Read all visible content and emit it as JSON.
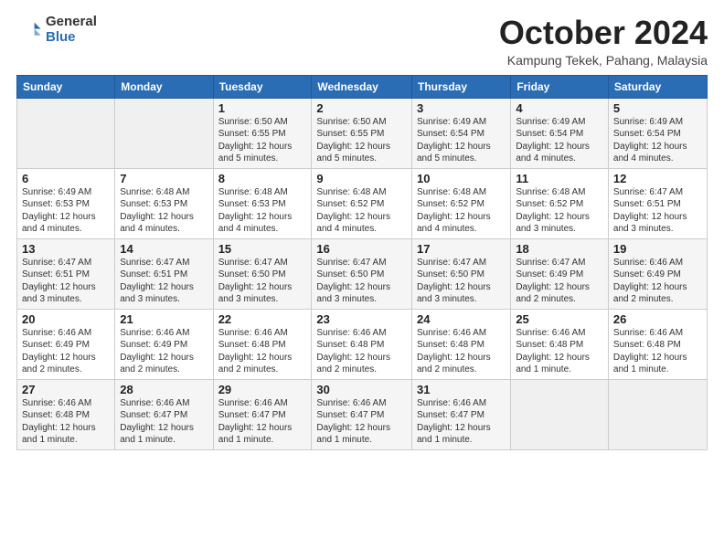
{
  "logo": {
    "general": "General",
    "blue": "Blue"
  },
  "header": {
    "month": "October 2024",
    "location": "Kampung Tekek, Pahang, Malaysia"
  },
  "weekdays": [
    "Sunday",
    "Monday",
    "Tuesday",
    "Wednesday",
    "Thursday",
    "Friday",
    "Saturday"
  ],
  "weeks": [
    [
      {
        "day": "",
        "sunrise": "",
        "sunset": "",
        "daylight": ""
      },
      {
        "day": "",
        "sunrise": "",
        "sunset": "",
        "daylight": ""
      },
      {
        "day": "1",
        "sunrise": "Sunrise: 6:50 AM",
        "sunset": "Sunset: 6:55 PM",
        "daylight": "Daylight: 12 hours and 5 minutes."
      },
      {
        "day": "2",
        "sunrise": "Sunrise: 6:50 AM",
        "sunset": "Sunset: 6:55 PM",
        "daylight": "Daylight: 12 hours and 5 minutes."
      },
      {
        "day": "3",
        "sunrise": "Sunrise: 6:49 AM",
        "sunset": "Sunset: 6:54 PM",
        "daylight": "Daylight: 12 hours and 5 minutes."
      },
      {
        "day": "4",
        "sunrise": "Sunrise: 6:49 AM",
        "sunset": "Sunset: 6:54 PM",
        "daylight": "Daylight: 12 hours and 4 minutes."
      },
      {
        "day": "5",
        "sunrise": "Sunrise: 6:49 AM",
        "sunset": "Sunset: 6:54 PM",
        "daylight": "Daylight: 12 hours and 4 minutes."
      }
    ],
    [
      {
        "day": "6",
        "sunrise": "Sunrise: 6:49 AM",
        "sunset": "Sunset: 6:53 PM",
        "daylight": "Daylight: 12 hours and 4 minutes."
      },
      {
        "day": "7",
        "sunrise": "Sunrise: 6:48 AM",
        "sunset": "Sunset: 6:53 PM",
        "daylight": "Daylight: 12 hours and 4 minutes."
      },
      {
        "day": "8",
        "sunrise": "Sunrise: 6:48 AM",
        "sunset": "Sunset: 6:53 PM",
        "daylight": "Daylight: 12 hours and 4 minutes."
      },
      {
        "day": "9",
        "sunrise": "Sunrise: 6:48 AM",
        "sunset": "Sunset: 6:52 PM",
        "daylight": "Daylight: 12 hours and 4 minutes."
      },
      {
        "day": "10",
        "sunrise": "Sunrise: 6:48 AM",
        "sunset": "Sunset: 6:52 PM",
        "daylight": "Daylight: 12 hours and 4 minutes."
      },
      {
        "day": "11",
        "sunrise": "Sunrise: 6:48 AM",
        "sunset": "Sunset: 6:52 PM",
        "daylight": "Daylight: 12 hours and 3 minutes."
      },
      {
        "day": "12",
        "sunrise": "Sunrise: 6:47 AM",
        "sunset": "Sunset: 6:51 PM",
        "daylight": "Daylight: 12 hours and 3 minutes."
      }
    ],
    [
      {
        "day": "13",
        "sunrise": "Sunrise: 6:47 AM",
        "sunset": "Sunset: 6:51 PM",
        "daylight": "Daylight: 12 hours and 3 minutes."
      },
      {
        "day": "14",
        "sunrise": "Sunrise: 6:47 AM",
        "sunset": "Sunset: 6:51 PM",
        "daylight": "Daylight: 12 hours and 3 minutes."
      },
      {
        "day": "15",
        "sunrise": "Sunrise: 6:47 AM",
        "sunset": "Sunset: 6:50 PM",
        "daylight": "Daylight: 12 hours and 3 minutes."
      },
      {
        "day": "16",
        "sunrise": "Sunrise: 6:47 AM",
        "sunset": "Sunset: 6:50 PM",
        "daylight": "Daylight: 12 hours and 3 minutes."
      },
      {
        "day": "17",
        "sunrise": "Sunrise: 6:47 AM",
        "sunset": "Sunset: 6:50 PM",
        "daylight": "Daylight: 12 hours and 3 minutes."
      },
      {
        "day": "18",
        "sunrise": "Sunrise: 6:47 AM",
        "sunset": "Sunset: 6:49 PM",
        "daylight": "Daylight: 12 hours and 2 minutes."
      },
      {
        "day": "19",
        "sunrise": "Sunrise: 6:46 AM",
        "sunset": "Sunset: 6:49 PM",
        "daylight": "Daylight: 12 hours and 2 minutes."
      }
    ],
    [
      {
        "day": "20",
        "sunrise": "Sunrise: 6:46 AM",
        "sunset": "Sunset: 6:49 PM",
        "daylight": "Daylight: 12 hours and 2 minutes."
      },
      {
        "day": "21",
        "sunrise": "Sunrise: 6:46 AM",
        "sunset": "Sunset: 6:49 PM",
        "daylight": "Daylight: 12 hours and 2 minutes."
      },
      {
        "day": "22",
        "sunrise": "Sunrise: 6:46 AM",
        "sunset": "Sunset: 6:48 PM",
        "daylight": "Daylight: 12 hours and 2 minutes."
      },
      {
        "day": "23",
        "sunrise": "Sunrise: 6:46 AM",
        "sunset": "Sunset: 6:48 PM",
        "daylight": "Daylight: 12 hours and 2 minutes."
      },
      {
        "day": "24",
        "sunrise": "Sunrise: 6:46 AM",
        "sunset": "Sunset: 6:48 PM",
        "daylight": "Daylight: 12 hours and 2 minutes."
      },
      {
        "day": "25",
        "sunrise": "Sunrise: 6:46 AM",
        "sunset": "Sunset: 6:48 PM",
        "daylight": "Daylight: 12 hours and 1 minute."
      },
      {
        "day": "26",
        "sunrise": "Sunrise: 6:46 AM",
        "sunset": "Sunset: 6:48 PM",
        "daylight": "Daylight: 12 hours and 1 minute."
      }
    ],
    [
      {
        "day": "27",
        "sunrise": "Sunrise: 6:46 AM",
        "sunset": "Sunset: 6:48 PM",
        "daylight": "Daylight: 12 hours and 1 minute."
      },
      {
        "day": "28",
        "sunrise": "Sunrise: 6:46 AM",
        "sunset": "Sunset: 6:47 PM",
        "daylight": "Daylight: 12 hours and 1 minute."
      },
      {
        "day": "29",
        "sunrise": "Sunrise: 6:46 AM",
        "sunset": "Sunset: 6:47 PM",
        "daylight": "Daylight: 12 hours and 1 minute."
      },
      {
        "day": "30",
        "sunrise": "Sunrise: 6:46 AM",
        "sunset": "Sunset: 6:47 PM",
        "daylight": "Daylight: 12 hours and 1 minute."
      },
      {
        "day": "31",
        "sunrise": "Sunrise: 6:46 AM",
        "sunset": "Sunset: 6:47 PM",
        "daylight": "Daylight: 12 hours and 1 minute."
      },
      {
        "day": "",
        "sunrise": "",
        "sunset": "",
        "daylight": ""
      },
      {
        "day": "",
        "sunrise": "",
        "sunset": "",
        "daylight": ""
      }
    ]
  ]
}
